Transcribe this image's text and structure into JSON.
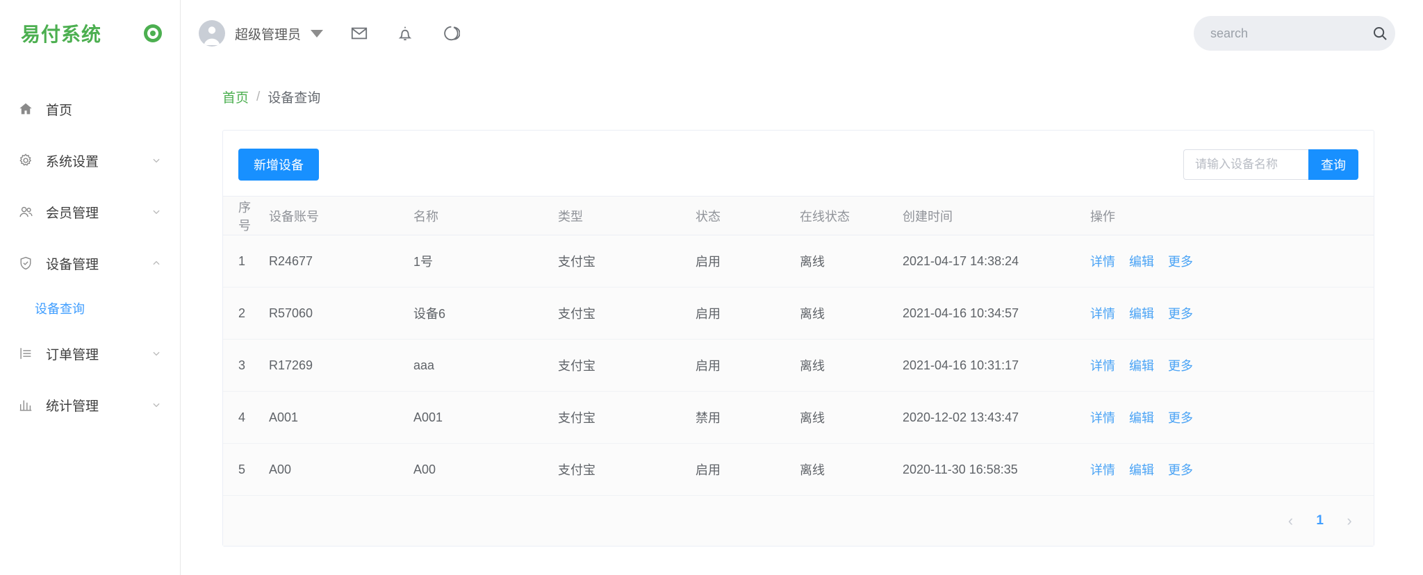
{
  "sidebar": {
    "brand": {
      "title": "易付系统",
      "mark_icon": "target-dot-icon"
    },
    "items": [
      {
        "label": "首页",
        "icon": "home-icon",
        "arrow": ""
      },
      {
        "label": "系统设置",
        "icon": "gear-icon",
        "arrow": "chevron-down"
      },
      {
        "label": "会员管理",
        "icon": "users-icon",
        "arrow": "chevron-down"
      },
      {
        "label": "设备管理",
        "icon": "shield-check-icon",
        "arrow": "chevron-up"
      },
      {
        "label": "订单管理",
        "icon": "list-icon",
        "arrow": "chevron-down"
      },
      {
        "label": "统计管理",
        "icon": "bar-chart-icon",
        "arrow": "chevron-down"
      }
    ],
    "sub_item": {
      "label": "设备查询"
    }
  },
  "topbar": {
    "username": "超级管理员",
    "avatar_icon": "user-avatar-icon",
    "caret_icon": "caret-down-icon",
    "mail_icon": "mail-icon",
    "bell_icon": "bell-icon",
    "moon_icon": "moon-icon",
    "search": {
      "value": "",
      "placeholder": "search",
      "icon": "search-icon"
    }
  },
  "breadcrumb": {
    "home": "首页",
    "separator": "/",
    "current": "设备查询"
  },
  "toolbar": {
    "add_label": "新增设备",
    "filter_value": "",
    "filter_placeholder": "请输入设备名称",
    "query_label": "查询"
  },
  "table": {
    "headers": [
      "序号",
      "设备账号",
      "名称",
      "类型",
      "状态",
      "在线状态",
      "创建时间",
      "操作"
    ],
    "rows": [
      {
        "idx": "1",
        "account": "R24677",
        "name": "1号",
        "type": "支付宝",
        "status": "启用",
        "online": "离线",
        "created": "2021-04-17 14:38:24",
        "ops": [
          "详情",
          "编辑",
          "更多"
        ]
      },
      {
        "idx": "2",
        "account": "R57060",
        "name": "设备6",
        "type": "支付宝",
        "status": "启用",
        "online": "离线",
        "created": "2021-04-16 10:34:57",
        "ops": [
          "详情",
          "编辑",
          "更多"
        ]
      },
      {
        "idx": "3",
        "account": "R17269",
        "name": "aaa",
        "type": "支付宝",
        "status": "启用",
        "online": "离线",
        "created": "2021-04-16 10:31:17",
        "ops": [
          "详情",
          "编辑",
          "更多"
        ]
      },
      {
        "idx": "4",
        "account": "A001",
        "name": "A001",
        "type": "支付宝",
        "status": "禁用",
        "online": "离线",
        "created": "2020-12-02 13:43:47",
        "ops": [
          "详情",
          "编辑",
          "更多"
        ]
      },
      {
        "idx": "5",
        "account": "A00",
        "name": "A00",
        "type": "支付宝",
        "status": "启用",
        "online": "离线",
        "created": "2020-11-30 16:58:35",
        "ops": [
          "详情",
          "编辑",
          "更多"
        ]
      }
    ]
  },
  "pagination": {
    "prev": "‹",
    "page": "1",
    "next": "›"
  },
  "colors": {
    "brand_green": "#4caf50",
    "primary_blue": "#1890ff",
    "link_blue": "#409eff",
    "status_enabled": "#33b14a",
    "status_disabled": "#f5222d",
    "status_offline": "#f5222d"
  }
}
